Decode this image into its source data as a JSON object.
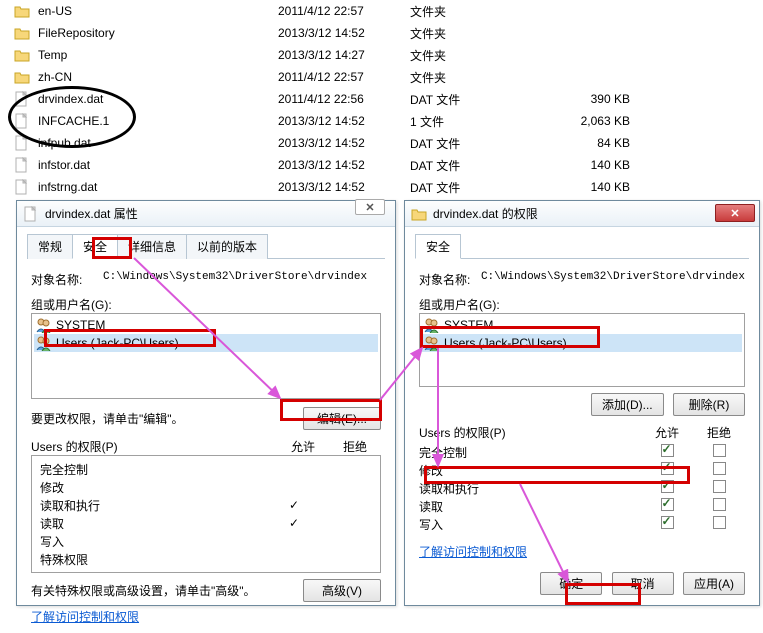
{
  "file_list": {
    "rows": [
      {
        "icon": "folder",
        "name": "en-US",
        "date": "2011/4/12 22:57",
        "type": "文件夹",
        "size": ""
      },
      {
        "icon": "folder",
        "name": "FileRepository",
        "date": "2013/3/12 14:52",
        "type": "文件夹",
        "size": ""
      },
      {
        "icon": "folder",
        "name": "Temp",
        "date": "2013/3/12 14:27",
        "type": "文件夹",
        "size": ""
      },
      {
        "icon": "folder",
        "name": "zh-CN",
        "date": "2011/4/12 22:57",
        "type": "文件夹",
        "size": ""
      },
      {
        "icon": "file",
        "name": "drvindex.dat",
        "date": "2011/4/12 22:56",
        "type": "DAT 文件",
        "size": "390 KB"
      },
      {
        "icon": "file",
        "name": "INFCACHE.1",
        "date": "2013/3/12 14:52",
        "type": "1 文件",
        "size": "2,063 KB"
      },
      {
        "icon": "file",
        "name": "infpub.dat",
        "date": "2013/3/12 14:52",
        "type": "DAT 文件",
        "size": "84 KB"
      },
      {
        "icon": "file",
        "name": "infstor.dat",
        "date": "2013/3/12 14:52",
        "type": "DAT 文件",
        "size": "140 KB"
      },
      {
        "icon": "file",
        "name": "infstrng.dat",
        "date": "2013/3/12 14:52",
        "type": "DAT 文件",
        "size": "140 KB"
      }
    ]
  },
  "dlg1": {
    "title": "drvindex.dat 属性",
    "close": "✕",
    "tabs": [
      "常规",
      "安全",
      "详细信息",
      "以前的版本"
    ],
    "object_label": "对象名称:",
    "object_path": "C:\\Windows\\System32\\DriverStore\\drvindex",
    "group_label": "组或用户名(G):",
    "users": [
      {
        "name": "SYSTEM",
        "selected": false
      },
      {
        "name": "Users (Jack-PC\\Users)",
        "selected": true
      }
    ],
    "edit_hint": "要更改权限，请单击\"编辑\"。",
    "edit_btn": "编辑(E)...",
    "perm_header": "Users 的权限(P)",
    "allow": "允许",
    "deny": "拒绝",
    "perms": [
      {
        "label": "完全控制",
        "allow": "",
        "deny": ""
      },
      {
        "label": "修改",
        "allow": "",
        "deny": ""
      },
      {
        "label": "读取和执行",
        "allow": "✓",
        "deny": ""
      },
      {
        "label": "读取",
        "allow": "✓",
        "deny": ""
      },
      {
        "label": "写入",
        "allow": "",
        "deny": ""
      },
      {
        "label": "特殊权限",
        "allow": "",
        "deny": ""
      }
    ],
    "adv_hint": "有关特殊权限或高级设置，请单击\"高级\"。",
    "adv_btn": "高级(V)",
    "link": "了解访问控制和权限"
  },
  "dlg2": {
    "title": "drvindex.dat 的权限",
    "tab": "安全",
    "object_label": "对象名称:",
    "object_path": "C:\\Windows\\System32\\DriverStore\\drvindex",
    "group_label": "组或用户名(G):",
    "users": [
      {
        "name": "SYSTEM",
        "selected": false
      },
      {
        "name": "Users (Jack-PC\\Users)",
        "selected": true
      }
    ],
    "add_btn": "添加(D)...",
    "remove_btn": "删除(R)",
    "perm_header": "Users 的权限(P)",
    "allow": "允许",
    "deny": "拒绝",
    "perms": [
      {
        "label": "完全控制",
        "allow": true,
        "deny": false
      },
      {
        "label": "修改",
        "allow": true,
        "deny": false
      },
      {
        "label": "读取和执行",
        "allow": true,
        "deny": false
      },
      {
        "label": "读取",
        "allow": true,
        "deny": false
      },
      {
        "label": "写入",
        "allow": true,
        "deny": false
      }
    ],
    "link": "了解访问控制和权限",
    "ok_btn": "确定",
    "cancel_btn": "取消",
    "apply_btn": "应用(A)"
  }
}
